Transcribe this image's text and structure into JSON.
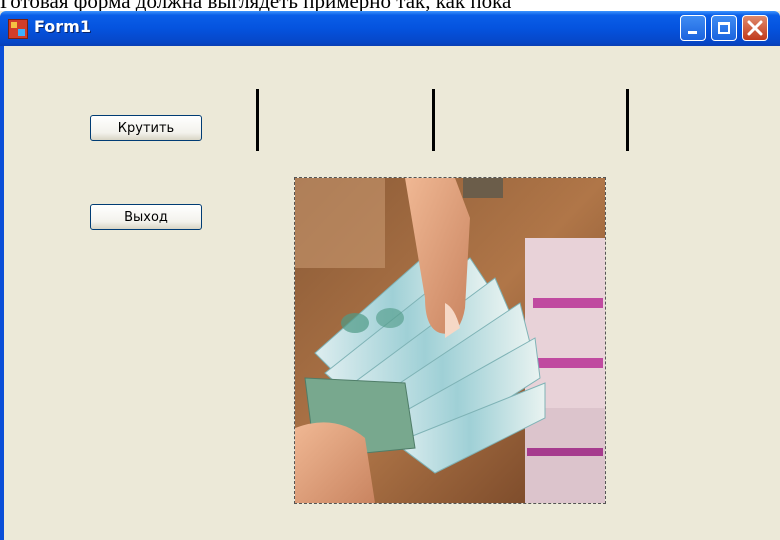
{
  "page": {
    "caption_above": "Готовая форма должна выглядеть примерно так, как пока"
  },
  "window": {
    "title": "Form1",
    "icons": {
      "app": "form-app-icon",
      "minimize": "minimize-icon",
      "maximize": "maximize-icon",
      "close": "close-icon"
    }
  },
  "buttons": {
    "spin_label": "Крутить",
    "exit_label": "Выход"
  },
  "slots": [
    "",
    "",
    ""
  ],
  "picture": {
    "subject": "money-photo"
  },
  "colors": {
    "titlebar": "#0553de",
    "form_background": "#ece9d8",
    "close_button": "#c0391b"
  }
}
